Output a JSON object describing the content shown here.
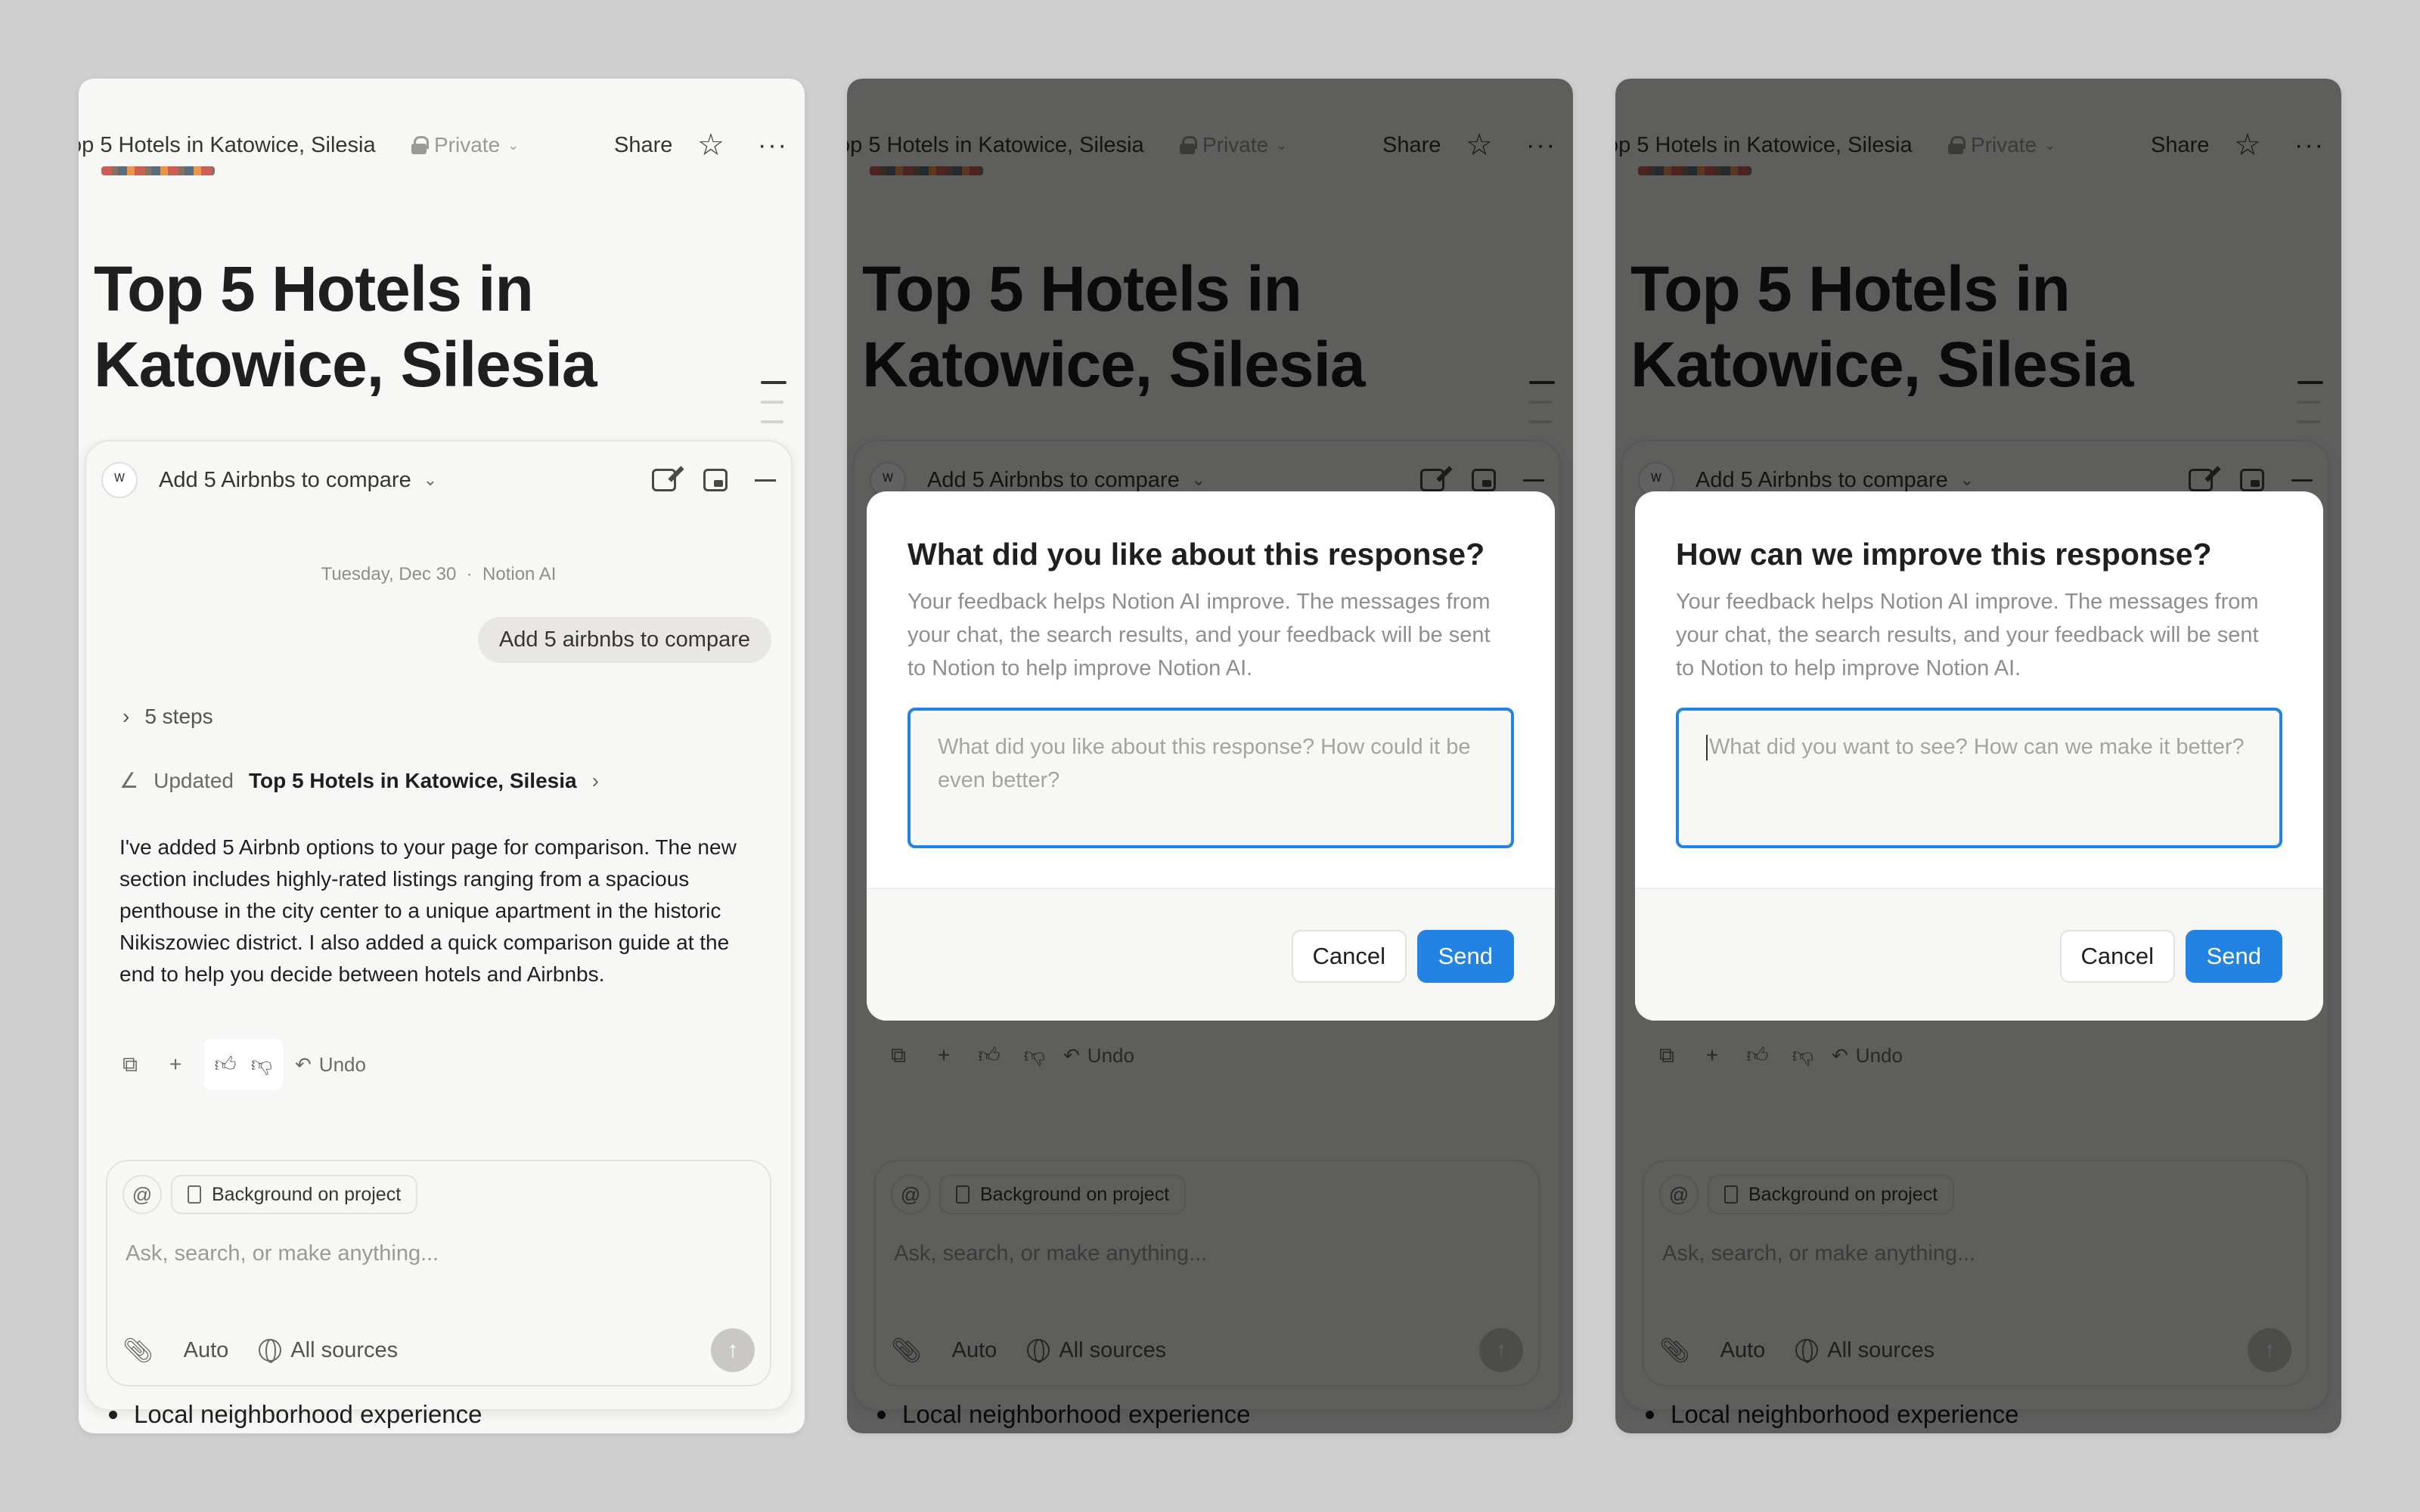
{
  "page": {
    "breadcrumb": "op 5 Hotels in Katowice, Silesia",
    "privacy": "Private",
    "share_label": "Share",
    "title": "Top 5 Hotels in Katowice, Silesia",
    "bullet_text": "Local neighborhood experience"
  },
  "ai": {
    "chat_title": "Add 5 Airbnbs to compare",
    "date": "Tuesday, Dec 30",
    "separator": "·",
    "assistant_name": "Notion AI",
    "user_message": "Add 5 airbnbs to compare",
    "steps_label": "5 steps",
    "updated_label": "Updated",
    "updated_page": "Top 5 Hotels in Katowice, Silesia",
    "answer": "I've added 5 Airbnb options to your page for comparison. The new section includes highly-rated listings ranging from a spacious penthouse in the city center to a unique apartment in the historic Nikiszowiec district. I also added a quick comparison guide at the end to help you decide between hotels and Airbnbs.",
    "undo_label": "Undo",
    "composer": {
      "context_chip": "Background on project",
      "placeholder": "Ask, search, or make anything...",
      "mode": "Auto",
      "sources": "All sources"
    }
  },
  "feedback_positive": {
    "title": "What did you like about this response?",
    "description": "Your feedback helps Notion AI improve. The messages from your chat, the search results, and your feedback will be sent to Notion to help improve Notion AI.",
    "placeholder": "What did you like about this response? How could it be even better?",
    "cancel": "Cancel",
    "send": "Send"
  },
  "feedback_negative": {
    "title": "How can we improve this response?",
    "description": "Your feedback helps Notion AI improve. The messages from your chat, the search results, and your feedback will be sent to Notion to help improve Notion AI.",
    "placeholder": "What did you want to see? How can we make it better?",
    "cancel": "Cancel",
    "send": "Send"
  },
  "colors": {
    "accent": "#2383e2",
    "background": "#cfcfcf",
    "panel": "#f7f7f5"
  }
}
